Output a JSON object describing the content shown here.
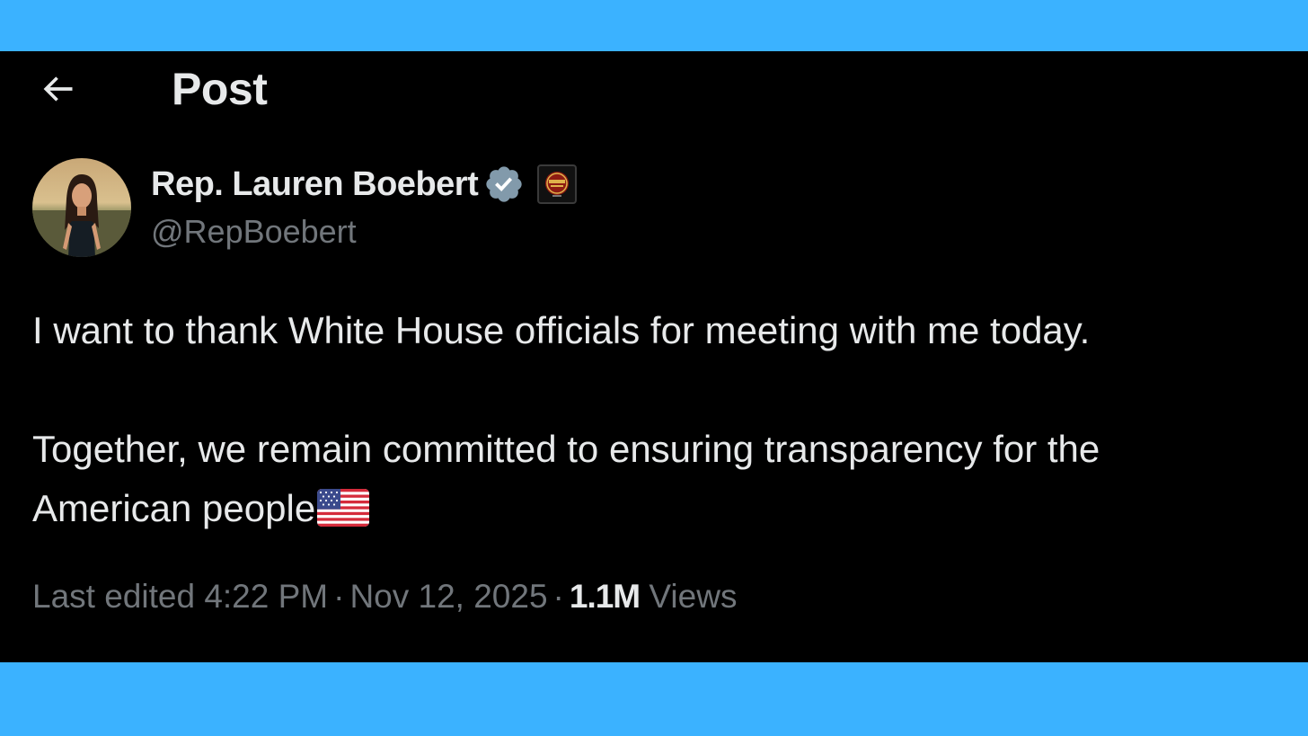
{
  "header": {
    "back_icon": "arrow-left-icon",
    "title": "Post"
  },
  "author": {
    "display_name": "Rep. Lauren Boebert",
    "handle": "@RepBoebert",
    "verified_icon": "verified-badge-icon",
    "verified_color": "#829aab",
    "affiliation_icon": "affiliation-badge-icon"
  },
  "tweet": {
    "paragraph_1": "I want to thank White House officials for meeting with me today.",
    "paragraph_2_line_1": "Together, we remain committed to ensuring transparency for the",
    "paragraph_2_line_2": "American people",
    "flag_icon": "us-flag-emoji-icon"
  },
  "meta": {
    "edited_prefix": "Last edited",
    "time": "4:22 PM",
    "separator": "·",
    "date": "Nov 12, 2025",
    "views_count": "1.1M",
    "views_label": "Views"
  },
  "colors": {
    "frame": "#3bb2ff",
    "background": "#000000",
    "primary_text": "#e7e9ea",
    "secondary_text": "#71767b"
  }
}
